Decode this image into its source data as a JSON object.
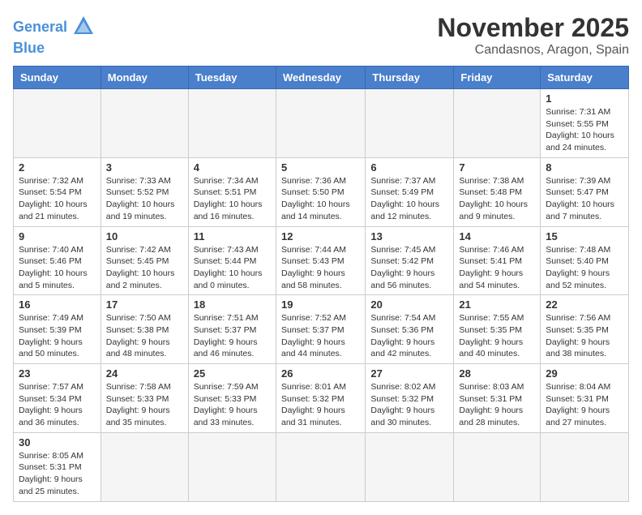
{
  "header": {
    "logo_line1": "General",
    "logo_line2": "Blue",
    "title": "November 2025",
    "subtitle": "Candasnos, Aragon, Spain"
  },
  "weekdays": [
    "Sunday",
    "Monday",
    "Tuesday",
    "Wednesday",
    "Thursday",
    "Friday",
    "Saturday"
  ],
  "weeks": [
    [
      {
        "day": "",
        "info": ""
      },
      {
        "day": "",
        "info": ""
      },
      {
        "day": "",
        "info": ""
      },
      {
        "day": "",
        "info": ""
      },
      {
        "day": "",
        "info": ""
      },
      {
        "day": "",
        "info": ""
      },
      {
        "day": "1",
        "info": "Sunrise: 7:31 AM\nSunset: 5:55 PM\nDaylight: 10 hours and 24 minutes."
      }
    ],
    [
      {
        "day": "2",
        "info": "Sunrise: 7:32 AM\nSunset: 5:54 PM\nDaylight: 10 hours and 21 minutes."
      },
      {
        "day": "3",
        "info": "Sunrise: 7:33 AM\nSunset: 5:52 PM\nDaylight: 10 hours and 19 minutes."
      },
      {
        "day": "4",
        "info": "Sunrise: 7:34 AM\nSunset: 5:51 PM\nDaylight: 10 hours and 16 minutes."
      },
      {
        "day": "5",
        "info": "Sunrise: 7:36 AM\nSunset: 5:50 PM\nDaylight: 10 hours and 14 minutes."
      },
      {
        "day": "6",
        "info": "Sunrise: 7:37 AM\nSunset: 5:49 PM\nDaylight: 10 hours and 12 minutes."
      },
      {
        "day": "7",
        "info": "Sunrise: 7:38 AM\nSunset: 5:48 PM\nDaylight: 10 hours and 9 minutes."
      },
      {
        "day": "8",
        "info": "Sunrise: 7:39 AM\nSunset: 5:47 PM\nDaylight: 10 hours and 7 minutes."
      }
    ],
    [
      {
        "day": "9",
        "info": "Sunrise: 7:40 AM\nSunset: 5:46 PM\nDaylight: 10 hours and 5 minutes."
      },
      {
        "day": "10",
        "info": "Sunrise: 7:42 AM\nSunset: 5:45 PM\nDaylight: 10 hours and 2 minutes."
      },
      {
        "day": "11",
        "info": "Sunrise: 7:43 AM\nSunset: 5:44 PM\nDaylight: 10 hours and 0 minutes."
      },
      {
        "day": "12",
        "info": "Sunrise: 7:44 AM\nSunset: 5:43 PM\nDaylight: 9 hours and 58 minutes."
      },
      {
        "day": "13",
        "info": "Sunrise: 7:45 AM\nSunset: 5:42 PM\nDaylight: 9 hours and 56 minutes."
      },
      {
        "day": "14",
        "info": "Sunrise: 7:46 AM\nSunset: 5:41 PM\nDaylight: 9 hours and 54 minutes."
      },
      {
        "day": "15",
        "info": "Sunrise: 7:48 AM\nSunset: 5:40 PM\nDaylight: 9 hours and 52 minutes."
      }
    ],
    [
      {
        "day": "16",
        "info": "Sunrise: 7:49 AM\nSunset: 5:39 PM\nDaylight: 9 hours and 50 minutes."
      },
      {
        "day": "17",
        "info": "Sunrise: 7:50 AM\nSunset: 5:38 PM\nDaylight: 9 hours and 48 minutes."
      },
      {
        "day": "18",
        "info": "Sunrise: 7:51 AM\nSunset: 5:37 PM\nDaylight: 9 hours and 46 minutes."
      },
      {
        "day": "19",
        "info": "Sunrise: 7:52 AM\nSunset: 5:37 PM\nDaylight: 9 hours and 44 minutes."
      },
      {
        "day": "20",
        "info": "Sunrise: 7:54 AM\nSunset: 5:36 PM\nDaylight: 9 hours and 42 minutes."
      },
      {
        "day": "21",
        "info": "Sunrise: 7:55 AM\nSunset: 5:35 PM\nDaylight: 9 hours and 40 minutes."
      },
      {
        "day": "22",
        "info": "Sunrise: 7:56 AM\nSunset: 5:35 PM\nDaylight: 9 hours and 38 minutes."
      }
    ],
    [
      {
        "day": "23",
        "info": "Sunrise: 7:57 AM\nSunset: 5:34 PM\nDaylight: 9 hours and 36 minutes."
      },
      {
        "day": "24",
        "info": "Sunrise: 7:58 AM\nSunset: 5:33 PM\nDaylight: 9 hours and 35 minutes."
      },
      {
        "day": "25",
        "info": "Sunrise: 7:59 AM\nSunset: 5:33 PM\nDaylight: 9 hours and 33 minutes."
      },
      {
        "day": "26",
        "info": "Sunrise: 8:01 AM\nSunset: 5:32 PM\nDaylight: 9 hours and 31 minutes."
      },
      {
        "day": "27",
        "info": "Sunrise: 8:02 AM\nSunset: 5:32 PM\nDaylight: 9 hours and 30 minutes."
      },
      {
        "day": "28",
        "info": "Sunrise: 8:03 AM\nSunset: 5:31 PM\nDaylight: 9 hours and 28 minutes."
      },
      {
        "day": "29",
        "info": "Sunrise: 8:04 AM\nSunset: 5:31 PM\nDaylight: 9 hours and 27 minutes."
      }
    ],
    [
      {
        "day": "30",
        "info": "Sunrise: 8:05 AM\nSunset: 5:31 PM\nDaylight: 9 hours and 25 minutes."
      },
      {
        "day": "",
        "info": ""
      },
      {
        "day": "",
        "info": ""
      },
      {
        "day": "",
        "info": ""
      },
      {
        "day": "",
        "info": ""
      },
      {
        "day": "",
        "info": ""
      },
      {
        "day": "",
        "info": ""
      }
    ]
  ]
}
